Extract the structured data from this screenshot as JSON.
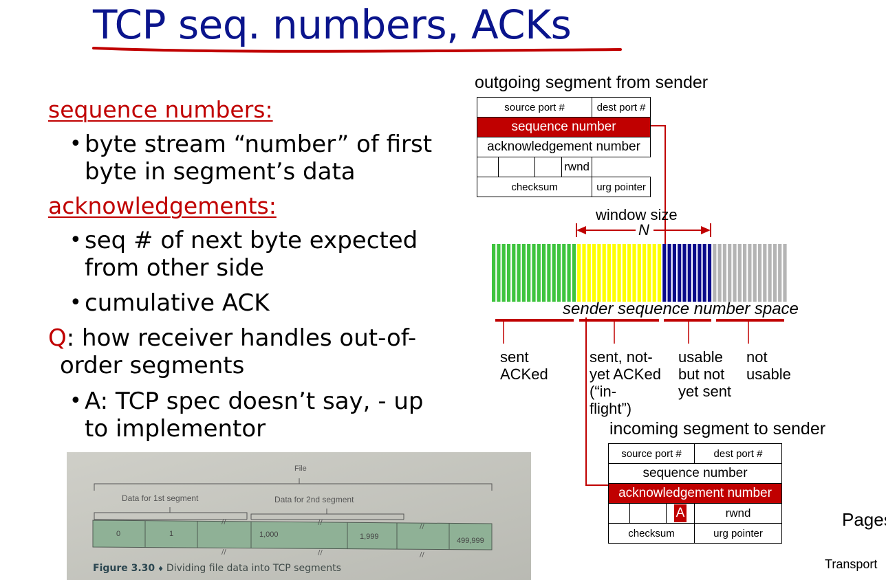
{
  "title": "TCP seq. numbers, ACKs",
  "left": {
    "seq_heading": "sequence numbers:",
    "seq_bullet_1": "byte stream “number” of first",
    "seq_bullet_2": "byte in segment’s data",
    "ack_heading": "acknowledgements:",
    "ack_bullet_1a": "seq # of next byte expected",
    "ack_bullet_1b": "from other side",
    "ack_bullet_2": "cumulative ACK",
    "q_prefix": "Q",
    "q_text_1": ": how receiver handles out-of-",
    "q_text_2": "order segments",
    "a_bullet_1": "A: TCP spec doesn’t say, - up",
    "a_bullet_2": "to implementor"
  },
  "outgoing": {
    "heading": "outgoing segment from sender",
    "source_port": "source port #",
    "dest_port": "dest port #",
    "sequence_number": "sequence number",
    "ack_number": "acknowledgement number",
    "rwnd": "rwnd",
    "checksum": "checksum",
    "urg_pointer": "urg pointer"
  },
  "window": {
    "label": "window size",
    "n": "N"
  },
  "sequence_space": {
    "label": "sender sequence number space",
    "colors": {
      "acked": "#3ec43e",
      "in_flight": "#ffff00",
      "usable": "#0a0a8c",
      "not_usable": "#b4b4b4"
    },
    "cat_sent_acked": [
      "sent",
      "ACKed"
    ],
    "cat_in_flight": [
      "sent, not-",
      "yet ACKed",
      "(“in-",
      "flight”)"
    ],
    "cat_usable": [
      "usable",
      "but not",
      "yet sent"
    ],
    "cat_not_usable": [
      "not",
      "usable"
    ]
  },
  "incoming": {
    "heading": "incoming segment to sender",
    "source_port": "source port #",
    "dest_port": "dest port #",
    "sequence_number": "sequence number",
    "ack_number": "acknowledgement number",
    "a_flag": "A",
    "rwnd": "rwnd",
    "checksum": "checksum",
    "urg_pointer": "urg pointer"
  },
  "figure": {
    "file_label": "File",
    "seg1_label": "Data for 1st segment",
    "seg2_label": "Data for 2nd segment",
    "cells": [
      "0",
      "1",
      "1,000",
      "1,999",
      "499,999"
    ],
    "caption_bold": "Figure 3.30",
    "caption_bullet": "♦",
    "caption_text": "Dividing file data into TCP segments"
  },
  "footer": {
    "pages": "Pages",
    "transport": "Transport"
  },
  "accent_red": "#c00000",
  "title_blue": "#0a148c"
}
